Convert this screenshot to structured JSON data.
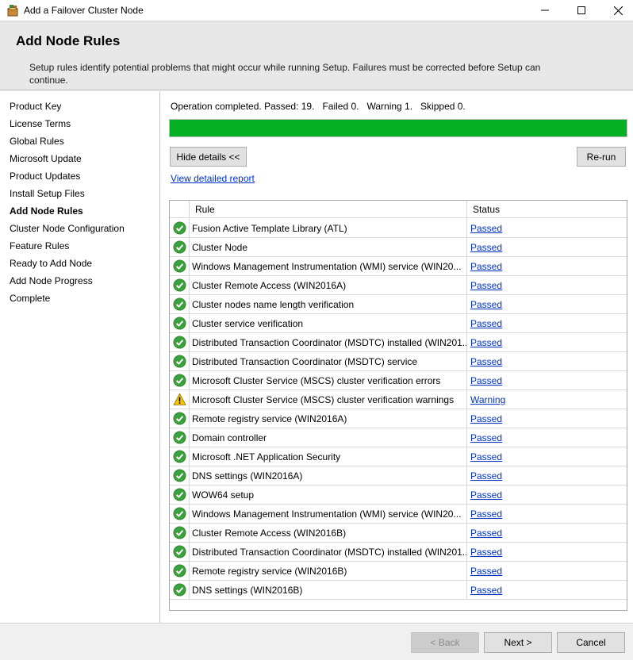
{
  "window": {
    "title": "Add a Failover Cluster Node",
    "icon": "setup-box-icon"
  },
  "header": {
    "title": "Add Node Rules",
    "description": "Setup rules identify potential problems that might occur while running Setup. Failures must be corrected before Setup can continue."
  },
  "nav": {
    "items": [
      {
        "label": "Product Key",
        "active": false
      },
      {
        "label": "License Terms",
        "active": false
      },
      {
        "label": "Global Rules",
        "active": false
      },
      {
        "label": "Microsoft Update",
        "active": false
      },
      {
        "label": "Product Updates",
        "active": false
      },
      {
        "label": "Install Setup Files",
        "active": false
      },
      {
        "label": "Add Node Rules",
        "active": true
      },
      {
        "label": "Cluster Node Configuration",
        "active": false
      },
      {
        "label": "Feature Rules",
        "active": false
      },
      {
        "label": "Ready to Add Node",
        "active": false
      },
      {
        "label": "Add Node Progress",
        "active": false
      },
      {
        "label": "Complete",
        "active": false
      }
    ]
  },
  "summary": {
    "status_line": "Operation completed. Passed: 19.   Failed 0.   Warning 1.   Skipped 0.",
    "progress_fraction": 1.0,
    "progress_color": "#06b025"
  },
  "actions": {
    "hide_details": "Hide details <<",
    "rerun": "Re-run",
    "view_report": "View detailed report"
  },
  "table": {
    "headers": {
      "rule": "Rule",
      "status": "Status"
    },
    "rows": [
      {
        "rule": "Fusion Active Template Library (ATL)",
        "status": "Passed",
        "icon": "check-icon"
      },
      {
        "rule": "Cluster Node",
        "status": "Passed",
        "icon": "check-icon"
      },
      {
        "rule": "Windows Management Instrumentation (WMI) service (WIN20...",
        "status": "Passed",
        "icon": "check-icon"
      },
      {
        "rule": "Cluster Remote Access (WIN2016A)",
        "status": "Passed",
        "icon": "check-icon"
      },
      {
        "rule": "Cluster nodes name length verification",
        "status": "Passed",
        "icon": "check-icon"
      },
      {
        "rule": "Cluster service verification",
        "status": "Passed",
        "icon": "check-icon"
      },
      {
        "rule": "Distributed Transaction Coordinator (MSDTC) installed (WIN201...",
        "status": "Passed",
        "icon": "check-icon"
      },
      {
        "rule": "Distributed Transaction Coordinator (MSDTC) service",
        "status": "Passed",
        "icon": "check-icon"
      },
      {
        "rule": "Microsoft Cluster Service (MSCS) cluster verification errors",
        "status": "Passed",
        "icon": "check-icon"
      },
      {
        "rule": "Microsoft Cluster Service (MSCS) cluster verification warnings",
        "status": "Warning",
        "icon": "warning-icon"
      },
      {
        "rule": "Remote registry service (WIN2016A)",
        "status": "Passed",
        "icon": "check-icon"
      },
      {
        "rule": "Domain controller",
        "status": "Passed",
        "icon": "check-icon"
      },
      {
        "rule": "Microsoft .NET Application Security",
        "status": "Passed",
        "icon": "check-icon"
      },
      {
        "rule": "DNS settings (WIN2016A)",
        "status": "Passed",
        "icon": "check-icon"
      },
      {
        "rule": "WOW64 setup",
        "status": "Passed",
        "icon": "check-icon"
      },
      {
        "rule": "Windows Management Instrumentation (WMI) service (WIN20...",
        "status": "Passed",
        "icon": "check-icon"
      },
      {
        "rule": "Cluster Remote Access (WIN2016B)",
        "status": "Passed",
        "icon": "check-icon"
      },
      {
        "rule": "Distributed Transaction Coordinator (MSDTC) installed (WIN201...",
        "status": "Passed",
        "icon": "check-icon"
      },
      {
        "rule": "Remote registry service (WIN2016B)",
        "status": "Passed",
        "icon": "check-icon"
      },
      {
        "rule": "DNS settings (WIN2016B)",
        "status": "Passed",
        "icon": "check-icon"
      }
    ]
  },
  "footer": {
    "back": "< Back",
    "next": "Next >",
    "cancel": "Cancel"
  },
  "colors": {
    "link": "#0033cc",
    "passed_icon": "#3ca13c",
    "warning_icon": "#f5c400"
  }
}
